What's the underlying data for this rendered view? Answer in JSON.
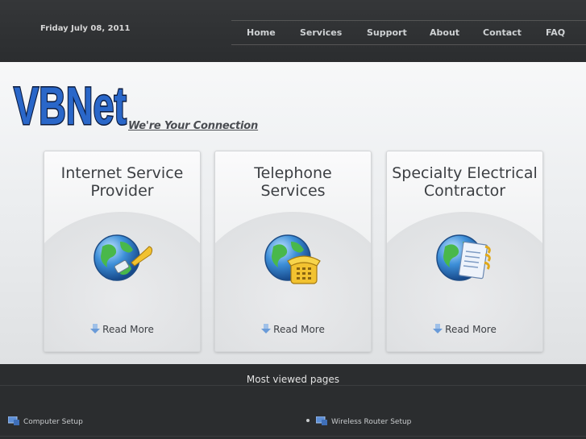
{
  "header": {
    "date": "Friday July 08, 2011",
    "nav": [
      {
        "label": "Home"
      },
      {
        "label": "Services"
      },
      {
        "label": "Support"
      },
      {
        "label": "About"
      },
      {
        "label": "Contact"
      },
      {
        "label": "FAQ"
      }
    ]
  },
  "brand": {
    "logo_text": "VBNet",
    "tagline": "We're Your Connection"
  },
  "cards": [
    {
      "title_line1": "Internet Service",
      "title_line2": "Provider",
      "icon": "globe-network-cable-icon",
      "link": "Read More"
    },
    {
      "title_line1": "Telephone",
      "title_line2": "Services",
      "icon": "globe-telephone-icon",
      "link": "Read More"
    },
    {
      "title_line1": "Specialty Electrical",
      "title_line2": "Contractor",
      "icon": "globe-document-icon",
      "link": "Read More"
    }
  ],
  "most_viewed": {
    "title": "Most viewed pages",
    "links": [
      {
        "label": "Computer Setup",
        "icon": "computer-icon"
      },
      {
        "label": "Wireless Router Setup",
        "icon": "computer-icon"
      }
    ]
  },
  "colors": {
    "header_bg": "#2f3133",
    "nav_text": "#cfd2d4",
    "logo_fill": "#2a67c9",
    "logo_outline": "#0b1a3d",
    "body_bg": "#eceef0"
  }
}
